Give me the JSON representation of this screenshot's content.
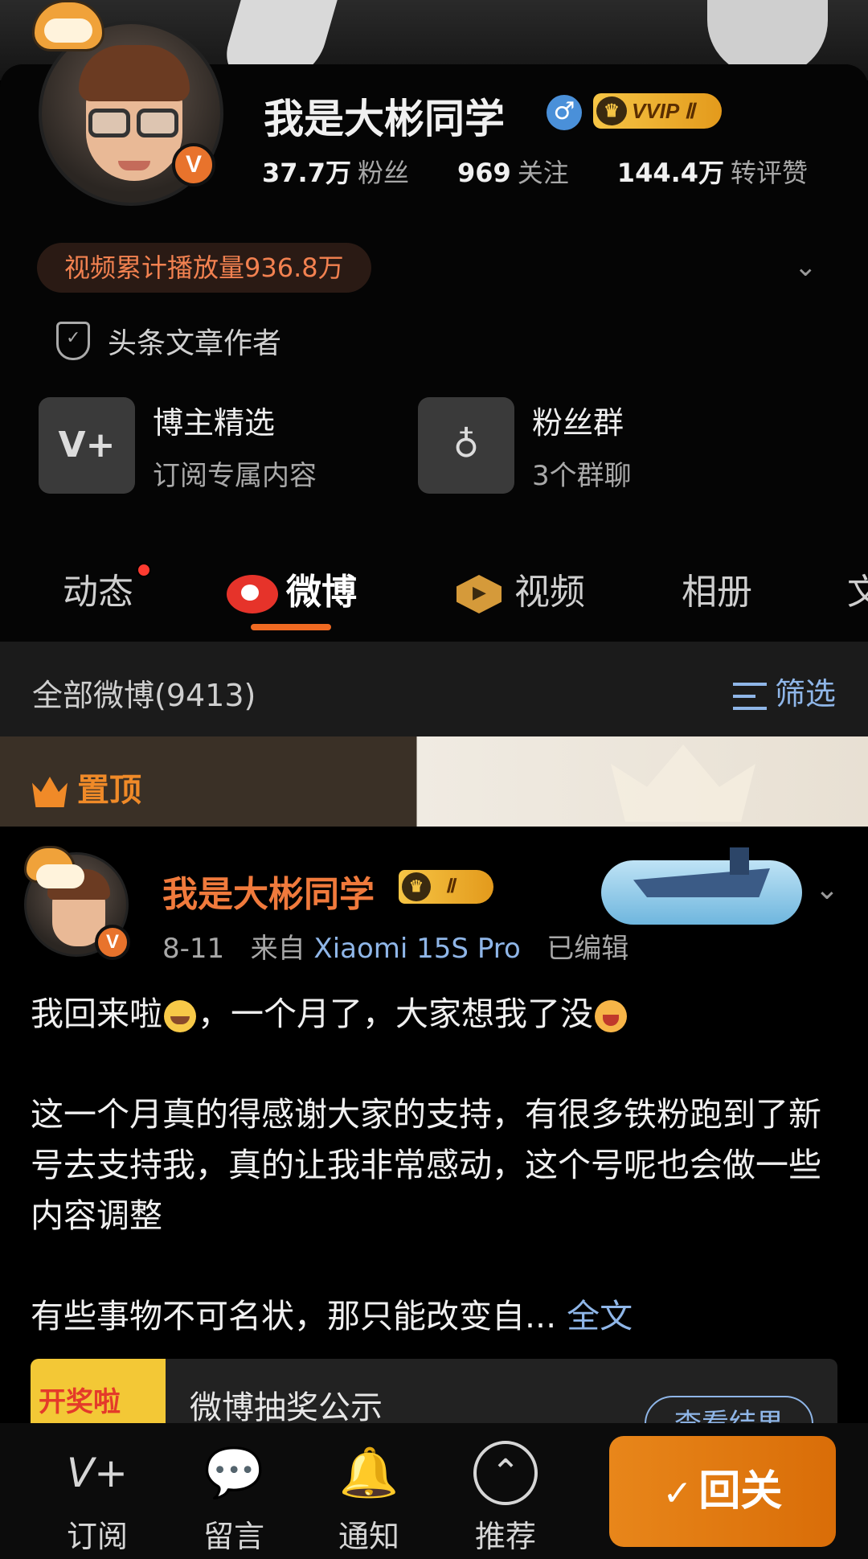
{
  "profile": {
    "name": "我是大彬同学",
    "gender_symbol": "♂",
    "vvip_label": "VVIP Ⅱ",
    "verified_badge": "V",
    "stats": [
      {
        "value": "37.7万",
        "label": "粉丝"
      },
      {
        "value": "969",
        "label": "关注"
      },
      {
        "value": "144.4万",
        "label": "转评赞"
      }
    ],
    "video_plays": "视频累计播放量936.8万",
    "author_tag": "头条文章作者"
  },
  "features": [
    {
      "icon": "V+",
      "title": "博主精选",
      "subtitle": "订阅专属内容"
    },
    {
      "icon": "♁",
      "title": "粉丝群",
      "subtitle": "3个群聊"
    }
  ],
  "tabs": [
    "动态",
    "微博",
    "视频",
    "相册",
    "文"
  ],
  "filter_bar": {
    "all_count": "全部微博(9413)",
    "filter_label": "筛选"
  },
  "pinned_label": "置顶",
  "post": {
    "author": "我是大彬同学",
    "level": "Ⅱ",
    "date": "8-11",
    "from_label": "来自",
    "device": "Xiaomi 15S Pro",
    "edited": "已编辑",
    "line1_a": "我回来啦",
    "line1_b": "，一个月了，大家想我了没",
    "para2": "这一个月真的得感谢大家的支持，有很多铁粉跑到了新号去支持我，真的让我非常感动，这个号呢也会做一些内容调整",
    "para3": "有些事物不可名状，那只能改变自...",
    "full_text": "全文"
  },
  "lottery_card": {
    "thumb_text": "开奖啦",
    "title": "微博抽奖公示",
    "button": "查看结果"
  },
  "bottom_nav": [
    {
      "icon": "V+",
      "label": "订阅"
    },
    {
      "icon": "💬",
      "label": "留言"
    },
    {
      "icon": "🔔",
      "label": "通知"
    },
    {
      "icon": "⌃",
      "label": "推荐"
    }
  ],
  "follow_button": "回关",
  "colors": {
    "accent": "#f06a22",
    "link": "#8fb6e8",
    "follow": "#e8861a"
  }
}
